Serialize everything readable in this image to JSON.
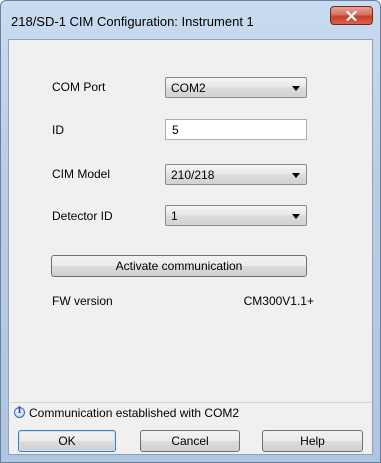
{
  "window": {
    "title": "218/SD-1 CIM Configuration: Instrument 1",
    "close_icon": "close-icon"
  },
  "form": {
    "com_port": {
      "label": "COM Port",
      "value": "COM2"
    },
    "id": {
      "label": "ID",
      "value": "5"
    },
    "cim_model": {
      "label": "CIM Model",
      "value": "210/218"
    },
    "detector_id": {
      "label": "Detector ID",
      "value": "1"
    },
    "activate_label": "Activate communication",
    "fw_label": "FW version",
    "fw_value": "CM300V1.1+"
  },
  "status": {
    "icon": "info-icon",
    "text": "Communication established with COM2"
  },
  "buttons": {
    "ok": "OK",
    "cancel": "Cancel",
    "help": "Help"
  }
}
